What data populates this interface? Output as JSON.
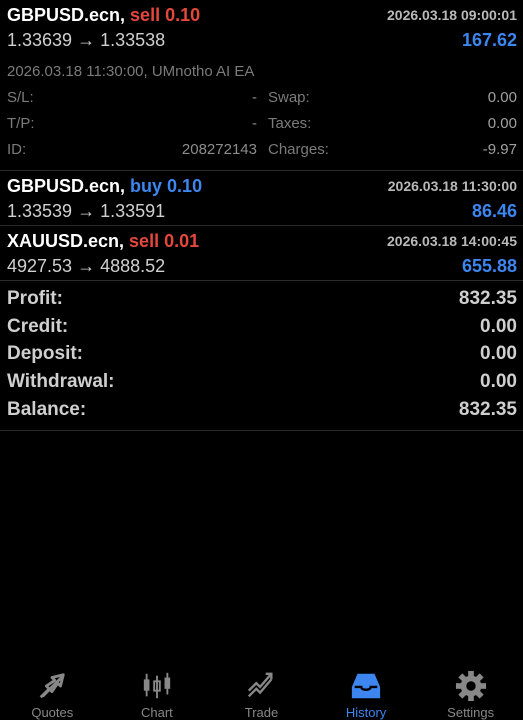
{
  "trades": [
    {
      "symbol": "GBPUSD.ecn,",
      "side": "sell 0.10",
      "time": "2026.03.18 09:00:01",
      "prices": "1.33639 → 1.33538",
      "profit": "167.62",
      "expanded": true,
      "detail": {
        "header": "2026.03.18 11:30:00, UMnotho AI EA",
        "sl_label": "S/L:",
        "sl_value": "-",
        "swap_label": "Swap:",
        "swap_value": "0.00",
        "tp_label": "T/P:",
        "tp_value": "-",
        "taxes_label": "Taxes:",
        "taxes_value": "0.00",
        "id_label": "ID:",
        "id_value": "208272143",
        "charges_label": "Charges:",
        "charges_value": "-9.97"
      }
    },
    {
      "symbol": "GBPUSD.ecn,",
      "side": "buy 0.10",
      "time": "2026.03.18 11:30:00",
      "prices": "1.33539 → 1.33591",
      "profit": "86.46"
    },
    {
      "symbol": "XAUUSD.ecn,",
      "side": "sell 0.01",
      "time": "2026.03.18 14:00:45",
      "prices": "4927.53 → 4888.52",
      "profit": "655.88"
    }
  ],
  "summary": {
    "profit_label": "Profit:",
    "profit_value": "832.35",
    "credit_label": "Credit:",
    "credit_value": "0.00",
    "deposit_label": "Deposit:",
    "deposit_value": "0.00",
    "withdrawal_label": "Withdrawal:",
    "withdrawal_value": "0.00",
    "balance_label": "Balance:",
    "balance_value": "832.35"
  },
  "tabs": [
    {
      "label": "Quotes",
      "icon": "quotes-icon"
    },
    {
      "label": "Chart",
      "icon": "chart-icon"
    },
    {
      "label": "Trade",
      "icon": "trade-icon"
    },
    {
      "label": "History",
      "icon": "history-icon",
      "active": true
    },
    {
      "label": "Settings",
      "icon": "settings-icon"
    }
  ],
  "colors": {
    "sell": "#e5473b",
    "buy": "#3d86f0",
    "accent": "#3d86f0"
  }
}
